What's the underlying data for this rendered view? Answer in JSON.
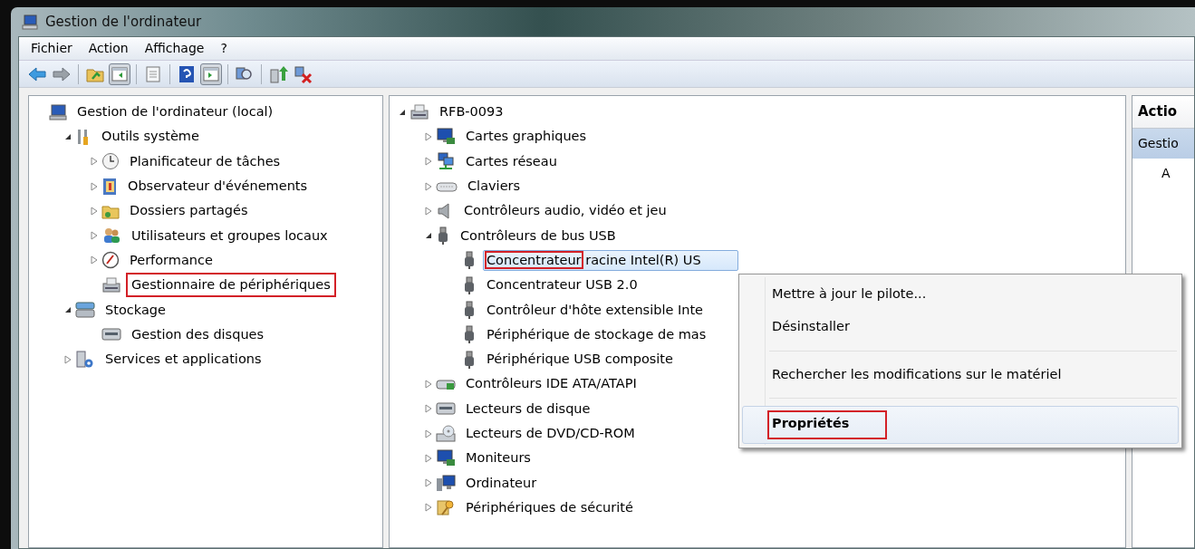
{
  "window": {
    "title": "Gestion de l'ordinateur"
  },
  "menu": [
    "Fichier",
    "Action",
    "Affichage",
    "?"
  ],
  "toolbar": [
    {
      "kind": "button",
      "pressed": false
    },
    {
      "kind": "button",
      "pressed": false
    },
    {
      "kind": "separator"
    },
    {
      "kind": "button",
      "pressed": false
    },
    {
      "kind": "button",
      "pressed": true
    },
    {
      "kind": "separator"
    },
    {
      "kind": "button",
      "pressed": false
    },
    {
      "kind": "separator"
    },
    {
      "kind": "button",
      "pressed": false
    },
    {
      "kind": "button",
      "pressed": true
    },
    {
      "kind": "separator"
    },
    {
      "kind": "button",
      "pressed": false
    },
    {
      "kind": "separator"
    },
    {
      "kind": "button",
      "pressed": false
    },
    {
      "kind": "button",
      "pressed": false
    }
  ],
  "console_tree": [
    {
      "label": "Gestion de l'ordinateur (local)",
      "children": [
        {
          "label": "Outils système",
          "expanded": true,
          "children": [
            {
              "label": "Planificateur de tâches",
              "expanded": false
            },
            {
              "label": "Observateur d'événements",
              "expanded": false
            },
            {
              "label": "Dossiers partagés",
              "expanded": false
            },
            {
              "label": "Utilisateurs et groupes locaux",
              "expanded": false
            },
            {
              "label": "Performance",
              "expanded": false
            },
            {
              "label": "Gestionnaire de périphériques",
              "boxed": true
            }
          ]
        },
        {
          "label": "Stockage",
          "expanded": true,
          "children": [
            {
              "label": "Gestion des disques"
            }
          ]
        },
        {
          "label": "Services et applications",
          "expanded": false
        }
      ]
    }
  ],
  "device_tree": [
    {
      "label": "RFB-0093",
      "expanded": true,
      "children": [
        {
          "label": "Cartes graphiques",
          "expanded": false
        },
        {
          "label": "Cartes réseau",
          "expanded": false
        },
        {
          "label": "Claviers",
          "expanded": false
        },
        {
          "label": "Contrôleurs audio, vidéo et jeu",
          "expanded": false
        },
        {
          "label": "Contrôleurs de bus USB",
          "expanded": true,
          "children": [
            {
              "label": "Concentrateur racine Intel(R) US",
              "selected": true,
              "first_word_boxed": true
            },
            {
              "label": "Concentrateur USB 2.0",
              "selected": false
            },
            {
              "label": "Contrôleur d'hôte extensible Inte",
              "selected": false
            },
            {
              "label": "Périphérique de stockage de mas",
              "selected": false
            },
            {
              "label": "Périphérique USB composite",
              "selected": false
            }
          ]
        },
        {
          "label": "Contrôleurs IDE ATA/ATAPI",
          "expanded": false
        },
        {
          "label": "Lecteurs de disque",
          "expanded": false
        },
        {
          "label": "Lecteurs de DVD/CD-ROM",
          "expanded": false
        },
        {
          "label": "Moniteurs",
          "expanded": false
        },
        {
          "label": "Ordinateur",
          "expanded": false
        },
        {
          "label": "Périphériques de sécurité",
          "expanded": false
        }
      ]
    }
  ],
  "context_menu": [
    {
      "kind": "command",
      "label": "Mettre à jour le pilote...",
      "hovered": false,
      "default": false
    },
    {
      "kind": "command",
      "label": "Désinstaller",
      "hovered": false,
      "default": false
    },
    {
      "kind": "separator"
    },
    {
      "kind": "command",
      "label": "Rechercher les modifications sur le matériel",
      "hovered": false,
      "default": false
    },
    {
      "kind": "separator"
    },
    {
      "kind": "command",
      "label": "Propriétés",
      "hovered": true,
      "default": true,
      "boxed": true
    }
  ],
  "actions_pane": {
    "header": "Actio",
    "items": [
      {
        "label": "Gestio",
        "selected": true,
        "children": [
          {
            "label": "A"
          }
        ]
      }
    ]
  }
}
